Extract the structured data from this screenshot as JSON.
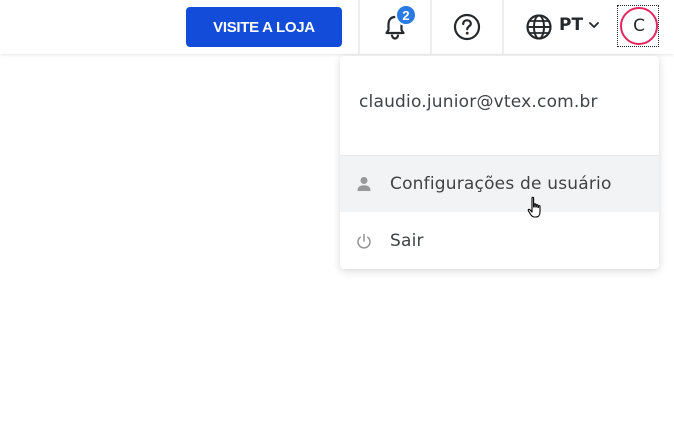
{
  "header": {
    "visit_store_label": "VISITE A LOJA",
    "notification_count": "2",
    "language_code": "PT",
    "avatar_initial": "C"
  },
  "user_menu": {
    "email": "claudio.junior@vtex.com.br",
    "items": [
      {
        "label": "Configurações de usuário",
        "icon": "person-icon"
      },
      {
        "label": "Sair",
        "icon": "power-icon"
      }
    ]
  },
  "colors": {
    "primary_button": "#134cd8",
    "badge": "#2a7be4",
    "avatar_ring": "#e0275f",
    "hover_bg": "#f2f3f5"
  }
}
